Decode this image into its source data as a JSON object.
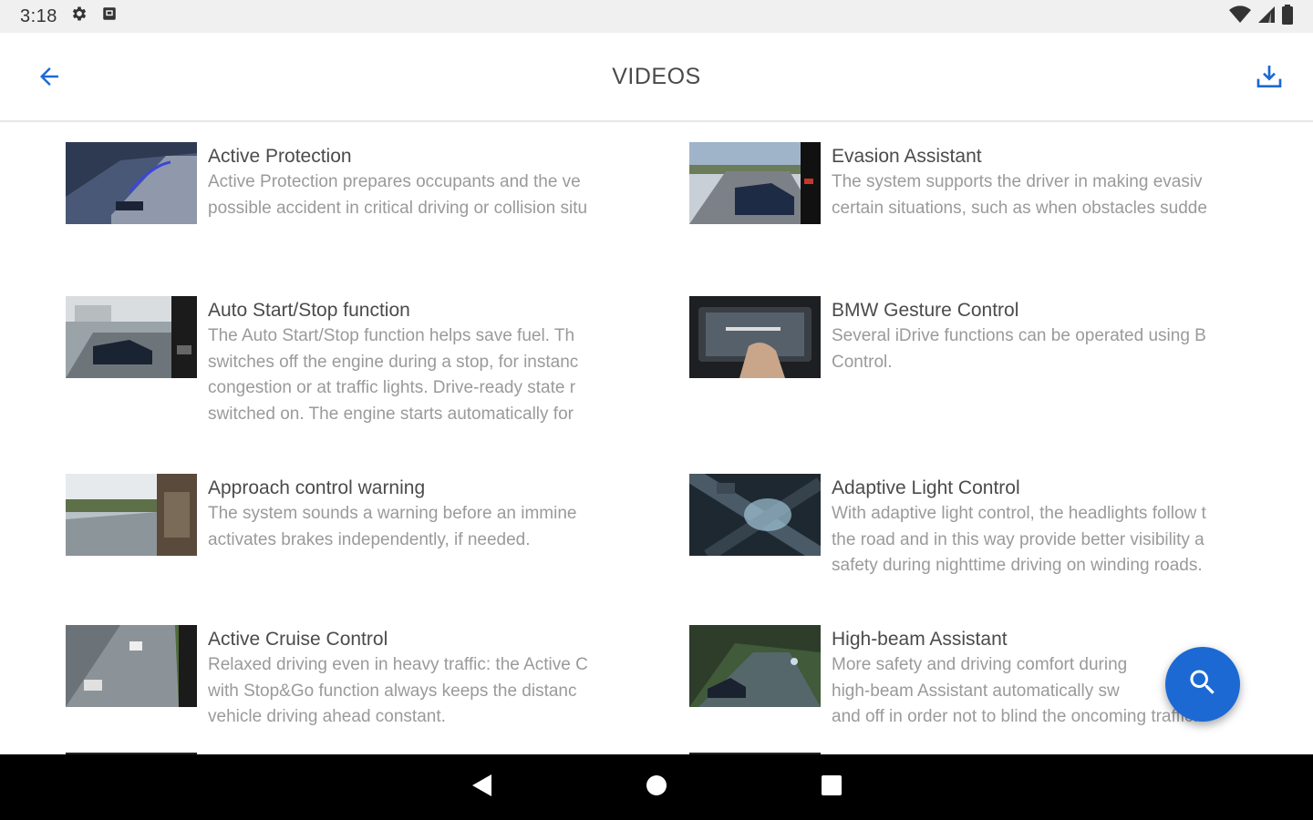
{
  "status_bar": {
    "time": "3:18",
    "icons": [
      "gear-icon",
      "notification-icon",
      "wifi-icon",
      "signal-icon",
      "battery-icon"
    ]
  },
  "app_bar": {
    "title": "VIDEOS",
    "back_icon": "arrow-back-icon",
    "download_icon": "download-icon",
    "accent_color": "#1c69d4"
  },
  "videos": [
    {
      "title": "Active Protection",
      "description": "Active Protection prepares occupants and the ve\npossible accident in critical driving or collision situ"
    },
    {
      "title": "Evasion Assistant",
      "description": "The system supports the driver in making evasiv\ncertain situations, such as when obstacles sudde"
    },
    {
      "title": "Auto Start/Stop function",
      "description": "The Auto Start/Stop function helps save fuel. Th\nswitches off the engine during a stop, for instanc\ncongestion or at traffic lights. Drive-ready state r\nswitched on. The engine starts automatically for"
    },
    {
      "title": "BMW Gesture Control",
      "description": "Several iDrive functions can be operated using B\nControl."
    },
    {
      "title": "Approach control warning",
      "description": "The system sounds a warning before an immine\nactivates brakes independently, if needed."
    },
    {
      "title": "Adaptive Light Control",
      "description": "With adaptive light control, the headlights follow t\nthe road and in this way provide better visibility a\nsafety during nighttime driving on winding roads."
    },
    {
      "title": "Active Cruise Control",
      "description": "Relaxed driving even in heavy traffic: the Active C\nwith Stop&Go function always keeps the distanc\nvehicle driving ahead constant."
    },
    {
      "title": "High-beam Assistant",
      "description": "More safety and driving comfort during\nhigh-beam Assistant automatically sw\nand off in order not to blind the oncoming traffic."
    }
  ],
  "fab": {
    "icon": "search-icon",
    "color": "#1c69d4"
  },
  "nav_bar": {
    "icons": [
      "back-triangle-icon",
      "home-circle-icon",
      "recents-square-icon"
    ]
  }
}
